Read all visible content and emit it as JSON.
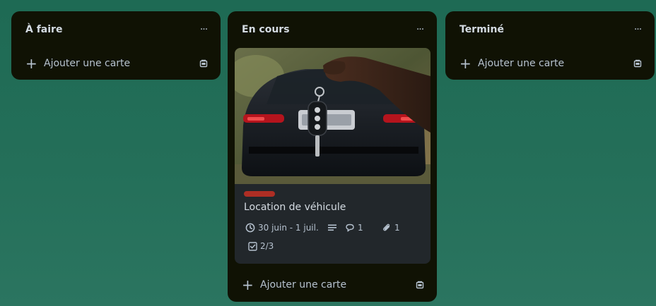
{
  "colors": {
    "background": "#1f6b55",
    "list_bg": "#101204",
    "card_bg": "#22272b",
    "text": "#b6c2cf",
    "label_red": "#ae2e24"
  },
  "lists": [
    {
      "title": "À faire",
      "menu_label": "···",
      "add_card_label": "Ajouter une carte",
      "icons": {
        "menu": "more-horizontal-icon",
        "add": "plus-icon",
        "template": "card-template-icon"
      }
    },
    {
      "title": "En cours",
      "menu_label": "···",
      "add_card_label": "Ajouter une carte",
      "icons": {
        "menu": "more-horizontal-icon",
        "add": "plus-icon",
        "template": "card-template-icon"
      }
    },
    {
      "title": "Terminé",
      "menu_label": "···",
      "add_card_label": "Ajouter une carte",
      "icons": {
        "menu": "more-horizontal-icon",
        "add": "plus-icon",
        "template": "card-template-icon"
      }
    }
  ],
  "card": {
    "title": "Location de véhicule",
    "cover_image": "hand-holding-car-key-in-front-of-dark-sedan",
    "label_color": "#ae2e24",
    "dates": "30 juin - 1 juil.",
    "comments": "1",
    "attachments": "1",
    "checklist": "2/3",
    "icons": {
      "dates": "clock-icon",
      "description": "description-lines-icon",
      "comments": "comment-icon",
      "attachments": "paperclip-icon",
      "checklist": "checklist-icon"
    }
  }
}
